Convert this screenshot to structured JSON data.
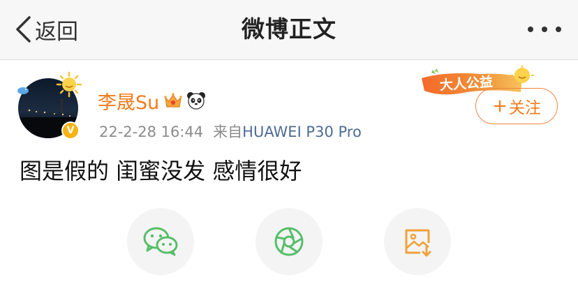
{
  "navbar": {
    "back_label": "返回",
    "title": "微博正文",
    "more_icon": "more-dots-icon"
  },
  "post": {
    "author": "李晟Su",
    "verified_mark": "V",
    "timestamp": "22-2-28 16:44",
    "source_prefix": "来自",
    "source": "HUAWEI P30 Pro",
    "banner_text": "大人公益",
    "follow_plus": "+",
    "follow_label": "关注",
    "text": "图是假的 闺蜜没发 感情很好"
  },
  "share": [
    {
      "icon": "wechat-icon"
    },
    {
      "icon": "moments-icon"
    },
    {
      "icon": "save-image-icon"
    }
  ],
  "colors": {
    "accent_orange": "#f37b1d",
    "source_blue": "#4e6b94",
    "share_green": "#57be6a",
    "save_orange": "#f0a23b"
  }
}
